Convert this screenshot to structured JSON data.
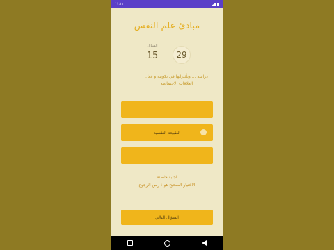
{
  "status_bar": {
    "time": "۱۱:۱۱",
    "battery": ""
  },
  "app": {
    "title": "مبادئ علم النفس",
    "score": "29",
    "counter_label": "السؤال",
    "counter_value": "15",
    "question": "دراسة ... وتأثيراتها في تكوينه و فعل العلاقات الاجتماعية",
    "options": [
      {
        "label": "",
        "selected": false
      },
      {
        "label": "الطبيعة النفسية",
        "selected": true
      },
      {
        "label": "",
        "selected": false
      }
    ],
    "feedback_line1": "اجابة خاطئة",
    "feedback_line2": "الاختيار الصحيح هو : زمن الرجوع",
    "next_label": "السؤال التالي"
  },
  "colors": {
    "accent": "#f0b51b",
    "background": "#efe8c6",
    "title": "#e5b026",
    "statusbar": "#5b3fc8",
    "outer": "#8e7a23"
  }
}
